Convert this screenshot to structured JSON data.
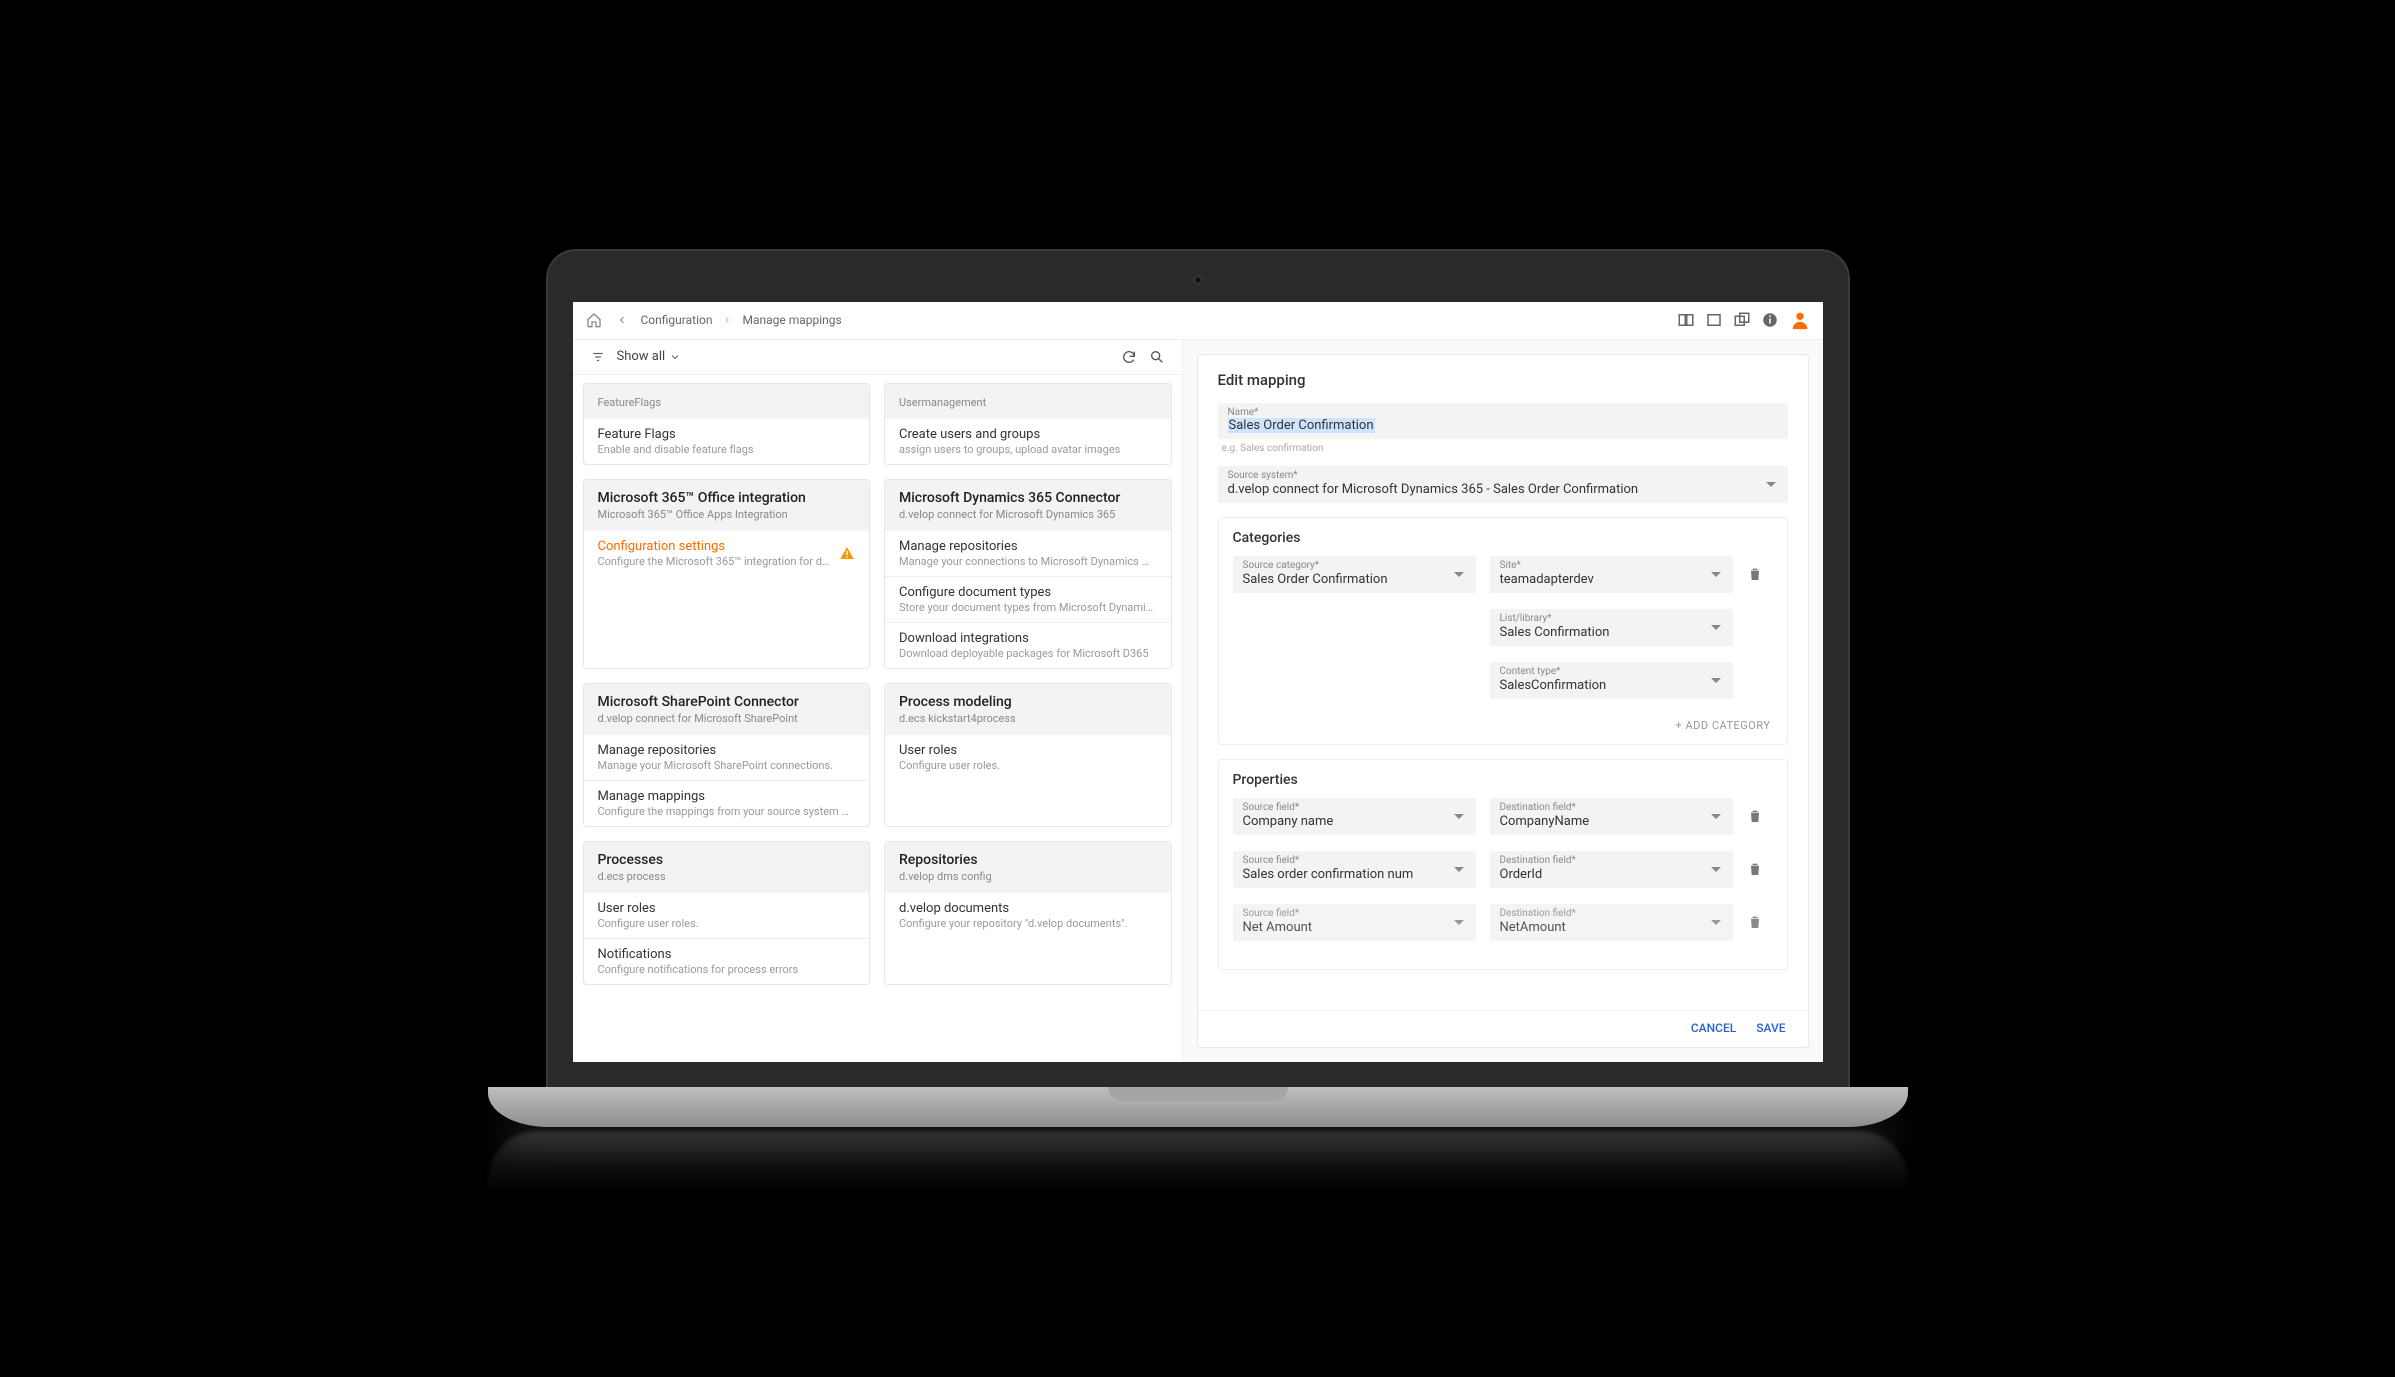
{
  "topbar": {
    "crumb1": "Configuration",
    "crumb2": "Manage mappings"
  },
  "filter": {
    "label": "Show all"
  },
  "cards": {
    "c0a": {
      "head_t": "",
      "head_s": "FeatureFlags",
      "i0t": "Feature Flags",
      "i0s": "Enable and disable feature flags"
    },
    "c0b": {
      "head_s": "Usermanagement",
      "i0t": "Create users and groups",
      "i0s": "assign users to groups, upload avatar images"
    },
    "c1a": {
      "head_t": "Microsoft 365™ Office integration",
      "head_s": "Microsoft 365™ Office Apps Integration",
      "i0t": "Configuration settings",
      "i0s": "Configure the Microsoft 365™ integration for d…"
    },
    "c1b": {
      "head_t": "Microsoft Dynamics 365 Connector",
      "head_s": "d.velop connect for Microsoft Dynamics 365",
      "i0t": "Manage repositories",
      "i0s": "Manage your connections to Microsoft Dynamics …",
      "i1t": "Configure document types",
      "i1s": "Store your document types from Microsoft Dynami…",
      "i2t": "Download integrations",
      "i2s": "Download deployable packages for Microsoft D365"
    },
    "c2a": {
      "head_t": "Microsoft SharePoint Connector",
      "head_s": "d.velop connect for Microsoft SharePoint",
      "i0t": "Manage repositories",
      "i0s": "Manage your Microsoft SharePoint connections.",
      "i1t": "Manage mappings",
      "i1s": "Configure the mappings from your source system …"
    },
    "c2b": {
      "head_t": "Process modeling",
      "head_s": "d.ecs kickstart4process",
      "i0t": "User roles",
      "i0s": "Configure user roles."
    },
    "c3a": {
      "head_t": "Processes",
      "head_s": "d.ecs process",
      "i0t": "User roles",
      "i0s": "Configure user roles.",
      "i1t": "Notifications",
      "i1s": "Configure notifications for process errors"
    },
    "c3b": {
      "head_t": "Repositories",
      "head_s": "d.velop dms config",
      "i0t": "d.velop documents",
      "i0s": "Configure your repository \"d.velop documents\"."
    }
  },
  "panel": {
    "title": "Edit mapping",
    "name_label": "Name*",
    "name_value": "Sales Order Confirmation",
    "name_hint": "e.g. Sales confirmation",
    "source_system_label": "Source system*",
    "source_system_value": "d.velop connect for Microsoft Dynamics 365 - Sales Order Confirmation",
    "categories_title": "Categories",
    "cat_source_label": "Source category*",
    "cat_source_value": "Sales Order Confirmation",
    "cat_site_label": "Site*",
    "cat_site_value": "teamadapterdev",
    "cat_list_label": "List/library*",
    "cat_list_value": "Sales Confirmation",
    "cat_ctype_label": "Content type*",
    "cat_ctype_value": "SalesConfirmation",
    "add_category": "+  ADD CATEGORY",
    "properties_title": "Properties",
    "p0_sl": "Source field*",
    "p0_sv": "Company name",
    "p0_dl": "Destination field*",
    "p0_dv": "CompanyName",
    "p1_sl": "Source field*",
    "p1_sv": "Sales order confirmation num",
    "p1_dl": "Destination field*",
    "p1_dv": "OrderId",
    "p2_sl": "Source field*",
    "p2_sv": "Net Amount",
    "p2_dl": "Destination field*",
    "p2_dv": "NetAmount",
    "cancel": "CANCEL",
    "save": "SAVE"
  }
}
